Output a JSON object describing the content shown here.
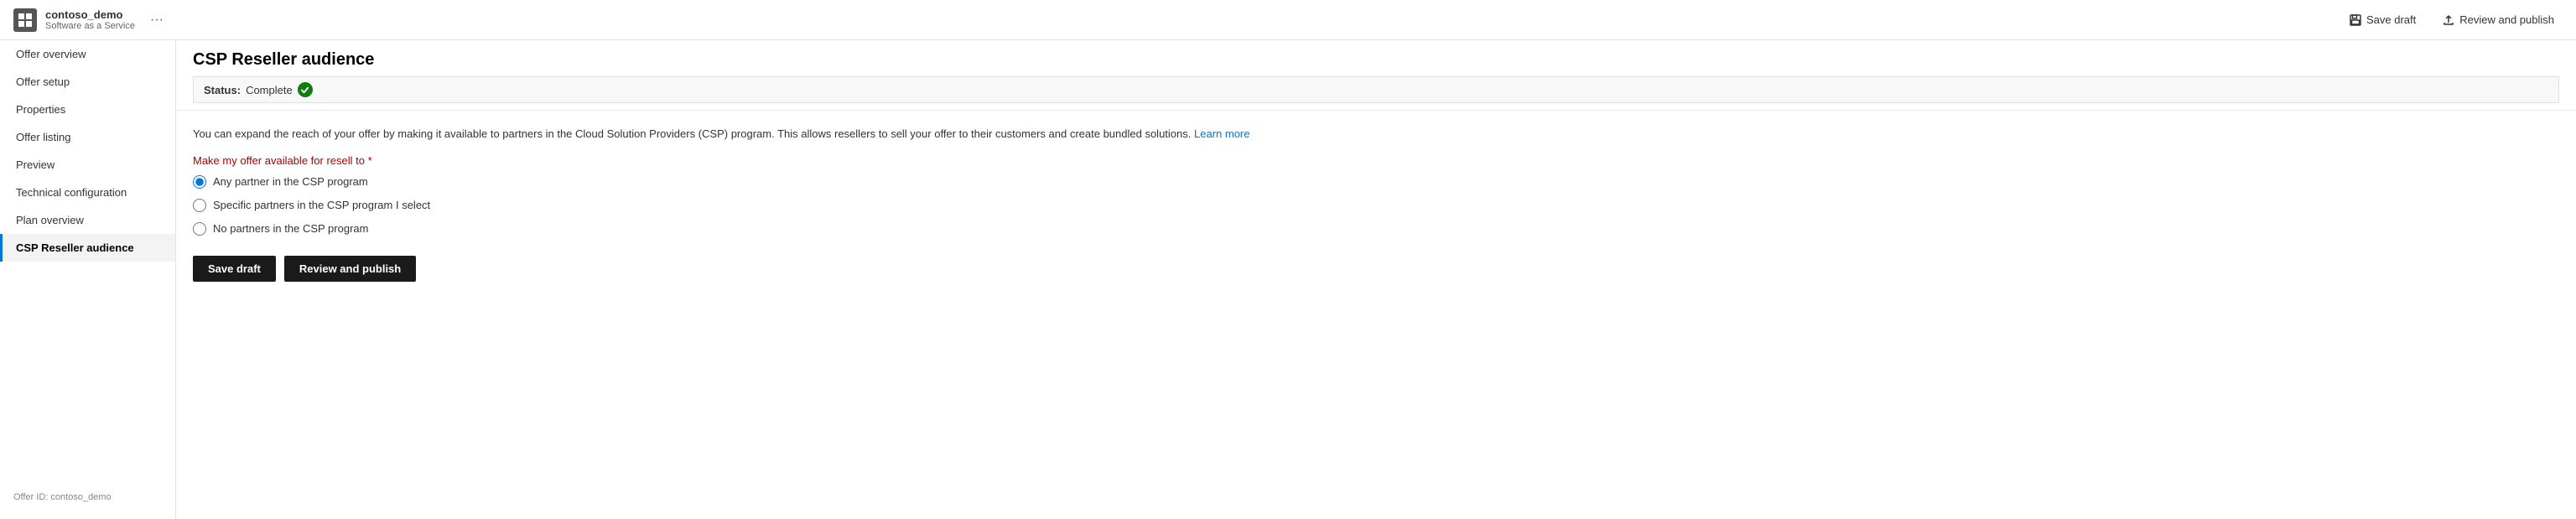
{
  "app": {
    "name": "contoso_demo",
    "subtitle": "Software as a Service",
    "icon_label": "grid-icon"
  },
  "header": {
    "save_draft_label": "Save draft",
    "review_publish_label": "Review and publish"
  },
  "sidebar": {
    "items": [
      {
        "id": "offer-overview",
        "label": "Offer overview",
        "active": false
      },
      {
        "id": "offer-setup",
        "label": "Offer setup",
        "active": false
      },
      {
        "id": "properties",
        "label": "Properties",
        "active": false
      },
      {
        "id": "offer-listing",
        "label": "Offer listing",
        "active": false
      },
      {
        "id": "preview",
        "label": "Preview",
        "active": false
      },
      {
        "id": "technical-configuration",
        "label": "Technical configuration",
        "active": false
      },
      {
        "id": "plan-overview",
        "label": "Plan overview",
        "active": false
      },
      {
        "id": "csp-reseller-audience",
        "label": "CSP Reseller audience",
        "active": true
      }
    ],
    "offer_id_label": "Offer ID: contoso_demo"
  },
  "content": {
    "title": "CSP Reseller audience",
    "status_label": "Status:",
    "status_value": "Complete",
    "description": "You can expand the reach of your offer by making it available to partners in the Cloud Solution Providers (CSP) program. This allows resellers to sell your offer to their customers and create bundled solutions.",
    "learn_more_label": "Learn more",
    "resell_label": "Make my offer available for resell to",
    "resell_required": "*",
    "radio_options": [
      {
        "id": "any-partner",
        "label": "Any partner in the CSP program",
        "checked": true
      },
      {
        "id": "specific-partners",
        "label": "Specific partners in the CSP program I select",
        "checked": false
      },
      {
        "id": "no-partners",
        "label": "No partners in the CSP program",
        "checked": false
      }
    ],
    "save_draft_label": "Save draft",
    "review_publish_label": "Review and publish"
  }
}
